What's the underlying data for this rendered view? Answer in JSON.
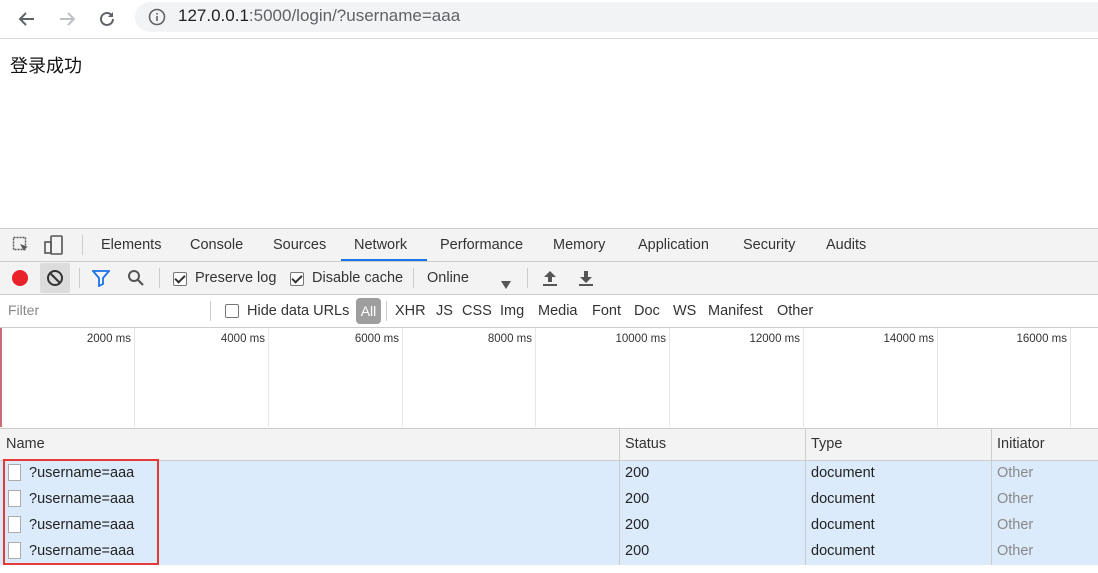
{
  "browser": {
    "url_host": "127.0.0.1",
    "url_rest": ":5000/login/?username=aaa"
  },
  "page": {
    "message": "登录成功"
  },
  "devtools": {
    "tabs": [
      "Elements",
      "Console",
      "Sources",
      "Network",
      "Performance",
      "Memory",
      "Application",
      "Security",
      "Audits"
    ],
    "active_tab": "Network",
    "toolbar": {
      "preserve_log": "Preserve log",
      "disable_cache": "Disable cache",
      "throttle": "Online"
    },
    "filter": {
      "placeholder": "Filter",
      "hide_data_urls": "Hide data URLs",
      "types": [
        "All",
        "XHR",
        "JS",
        "CSS",
        "Img",
        "Media",
        "Font",
        "Doc",
        "WS",
        "Manifest",
        "Other"
      ]
    },
    "timeline": {
      "ticks": [
        "2000 ms",
        "4000 ms",
        "6000 ms",
        "8000 ms",
        "10000 ms",
        "12000 ms",
        "14000 ms",
        "16000 ms"
      ]
    },
    "columns": {
      "name": "Name",
      "status": "Status",
      "type": "Type",
      "initiator": "Initiator"
    },
    "requests": [
      {
        "name": "?username=aaa",
        "status": "200",
        "type": "document",
        "initiator": "Other"
      },
      {
        "name": "?username=aaa",
        "status": "200",
        "type": "document",
        "initiator": "Other"
      },
      {
        "name": "?username=aaa",
        "status": "200",
        "type": "document",
        "initiator": "Other"
      },
      {
        "name": "?username=aaa",
        "status": "200",
        "type": "document",
        "initiator": "Other"
      }
    ]
  },
  "colors": {
    "accent": "#1a73e8",
    "record": "#e8212b",
    "highlight_box": "#e53935",
    "row_selected": "#dcebfb"
  }
}
